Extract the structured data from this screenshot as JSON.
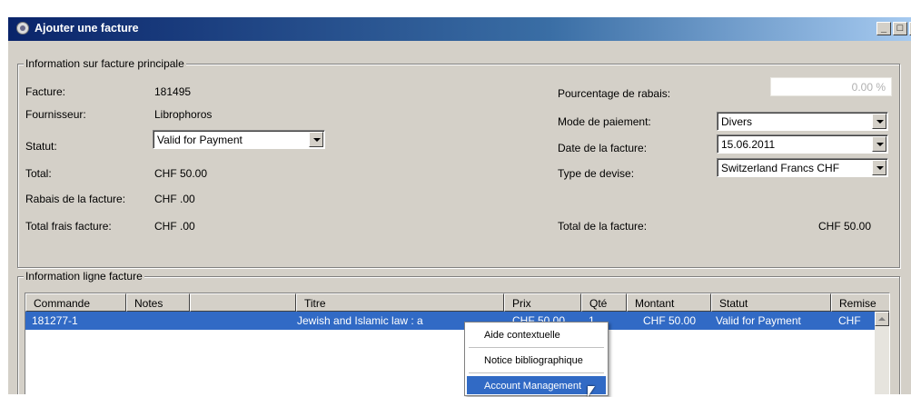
{
  "window": {
    "title": "Ajouter une facture",
    "minimize_symbol": "_",
    "maximize_symbol": "□",
    "close_symbol": "×"
  },
  "main_info": {
    "group_title": "Information sur facture principale",
    "facture_label": "Facture:",
    "facture_value": "181495",
    "fournisseur_label": "Fournisseur:",
    "fournisseur_value": "Librophoros",
    "statut_label": "Statut:",
    "statut_value": "Valid for Payment",
    "total_label": "Total:",
    "total_value": "CHF 50.00",
    "rabais_label": "Rabais de la facture:",
    "rabais_value": "CHF .00",
    "frais_label": "Total frais facture:",
    "frais_value": "CHF .00",
    "pourcentage_label": "Pourcentage de rabais:",
    "pourcentage_value": "0.00 %",
    "mode_label": "Mode de paiement:",
    "mode_value": "Divers",
    "date_label": "Date de la facture:",
    "date_value": "15.06.2011",
    "devise_label": "Type de devise:",
    "devise_value": "Switzerland Francs  CHF",
    "total_facture_label": "Total de la facture:",
    "total_facture_value": "CHF 50.00"
  },
  "lines": {
    "group_title": "Information ligne facture",
    "columns": {
      "commande": "Commande",
      "notes": "Notes",
      "blank": "",
      "titre": "Titre",
      "prix": "Prix",
      "qte": "Qté",
      "montant": "Montant",
      "statut": "Statut",
      "remise": "Remise"
    },
    "row": {
      "commande": "181277-1",
      "titre": "Jewish and Islamic law : a",
      "prix": "CHF 50.00",
      "qte": "1",
      "montant": "CHF 50.00",
      "statut": "Valid for Payment",
      "remise": "CHF"
    }
  },
  "context_menu": {
    "items": [
      "Aide contextuelle",
      "Notice bibliographique",
      "Account Management"
    ],
    "highlighted": "Account Management"
  },
  "colors": {
    "title_bar_start": "#0a246a",
    "title_bar_end": "#a6caf0",
    "selection": "#316ac5",
    "window_face": "#d4d0c8"
  }
}
